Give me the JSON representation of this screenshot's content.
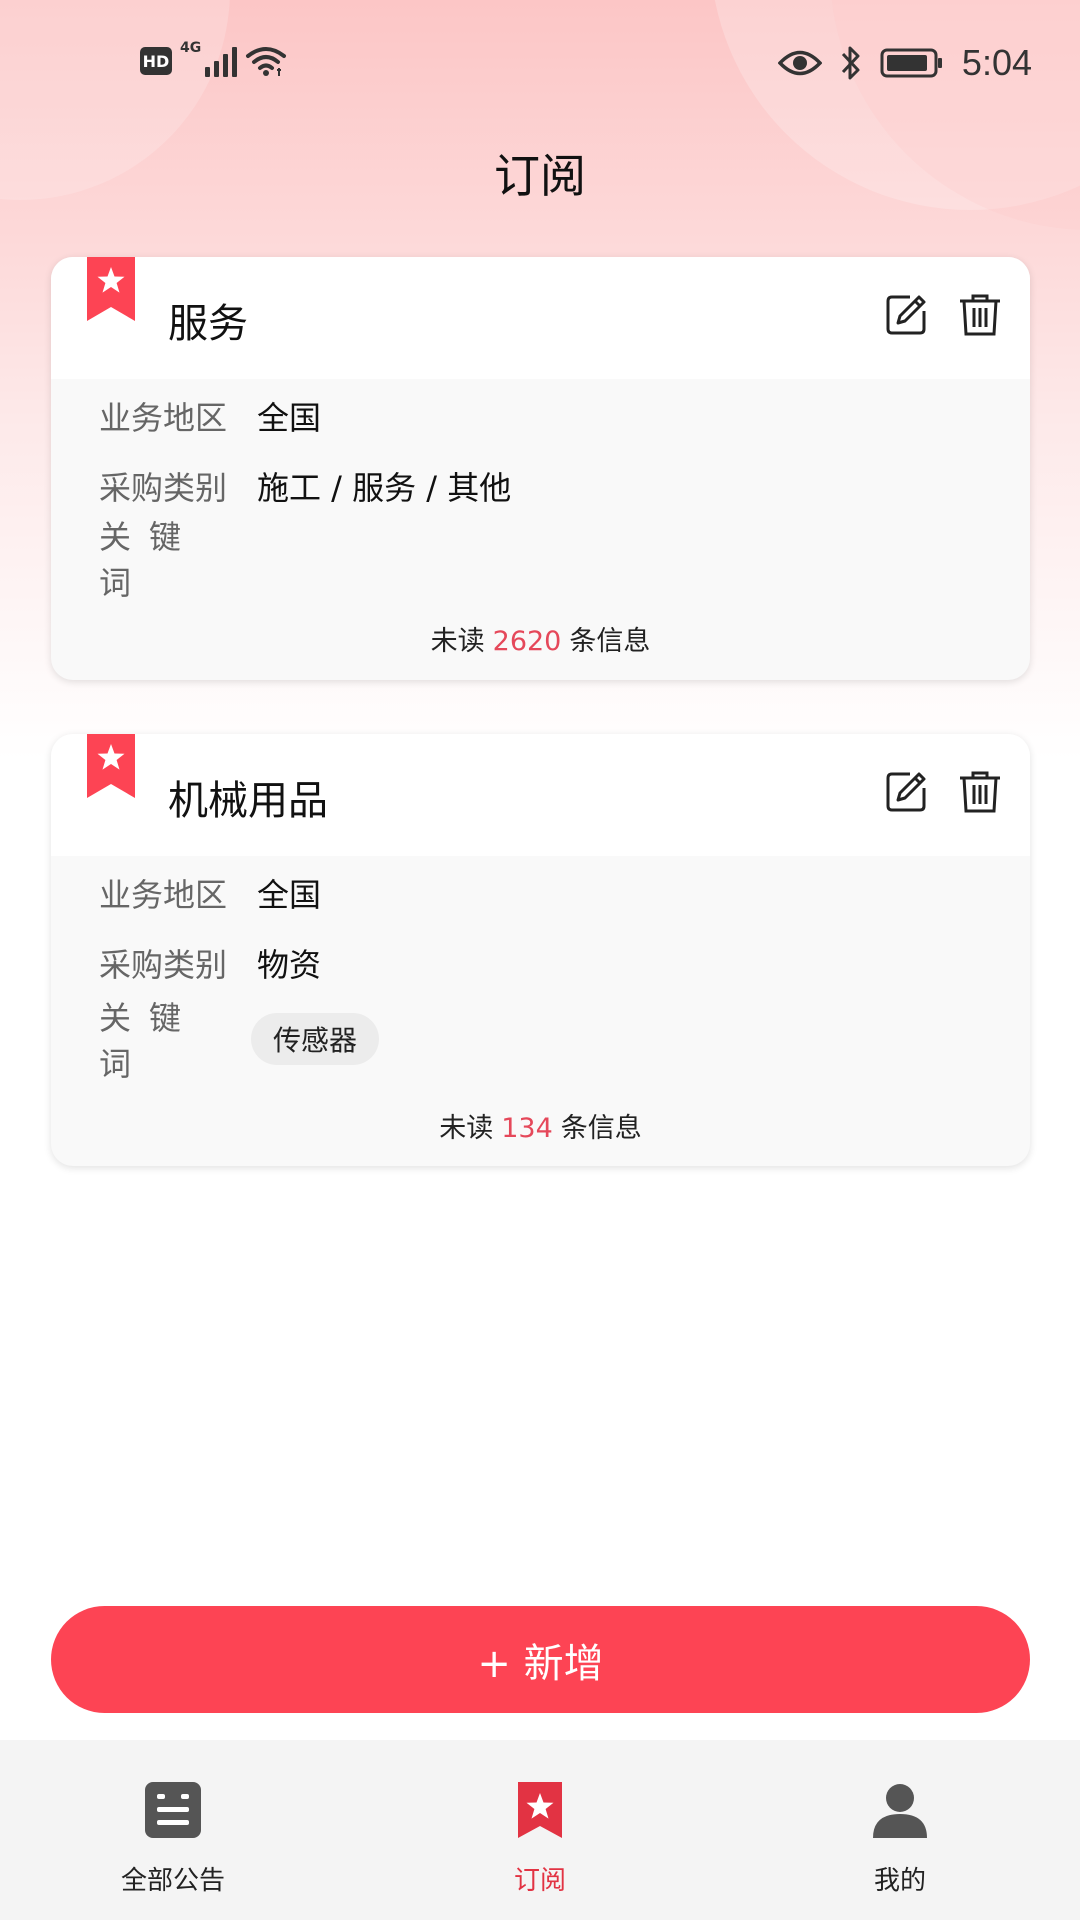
{
  "status_bar": {
    "hd": "HD",
    "network": "4G",
    "time": "5:04"
  },
  "page": {
    "title": "订阅"
  },
  "subscriptions": [
    {
      "title": "服务",
      "region_label": "业务地区",
      "region": "全国",
      "category_label": "采购类别",
      "category": "施工 / 服务 / 其他",
      "keyword_label": "关键词",
      "keywords": [],
      "unread_prefix": "未读",
      "unread_count": "2620",
      "unread_suffix": "条信息"
    },
    {
      "title": "机械用品",
      "region_label": "业务地区",
      "region": "全国",
      "category_label": "采购类别",
      "category": "物资",
      "keyword_label": "关键词",
      "keywords": [
        "传感器"
      ],
      "unread_prefix": "未读",
      "unread_count": "134",
      "unread_suffix": "条信息"
    }
  ],
  "add_button": {
    "label": "+ 新增"
  },
  "bottom_nav": {
    "items": [
      {
        "label": "全部公告",
        "icon": "list-icon",
        "active": false
      },
      {
        "label": "订阅",
        "icon": "bookmark-star-icon",
        "active": true
      },
      {
        "label": "我的",
        "icon": "person-icon",
        "active": false
      }
    ]
  },
  "colors": {
    "accent": "#fd4454",
    "unread_count": "#e5485a",
    "active_nav": "#e23343"
  }
}
